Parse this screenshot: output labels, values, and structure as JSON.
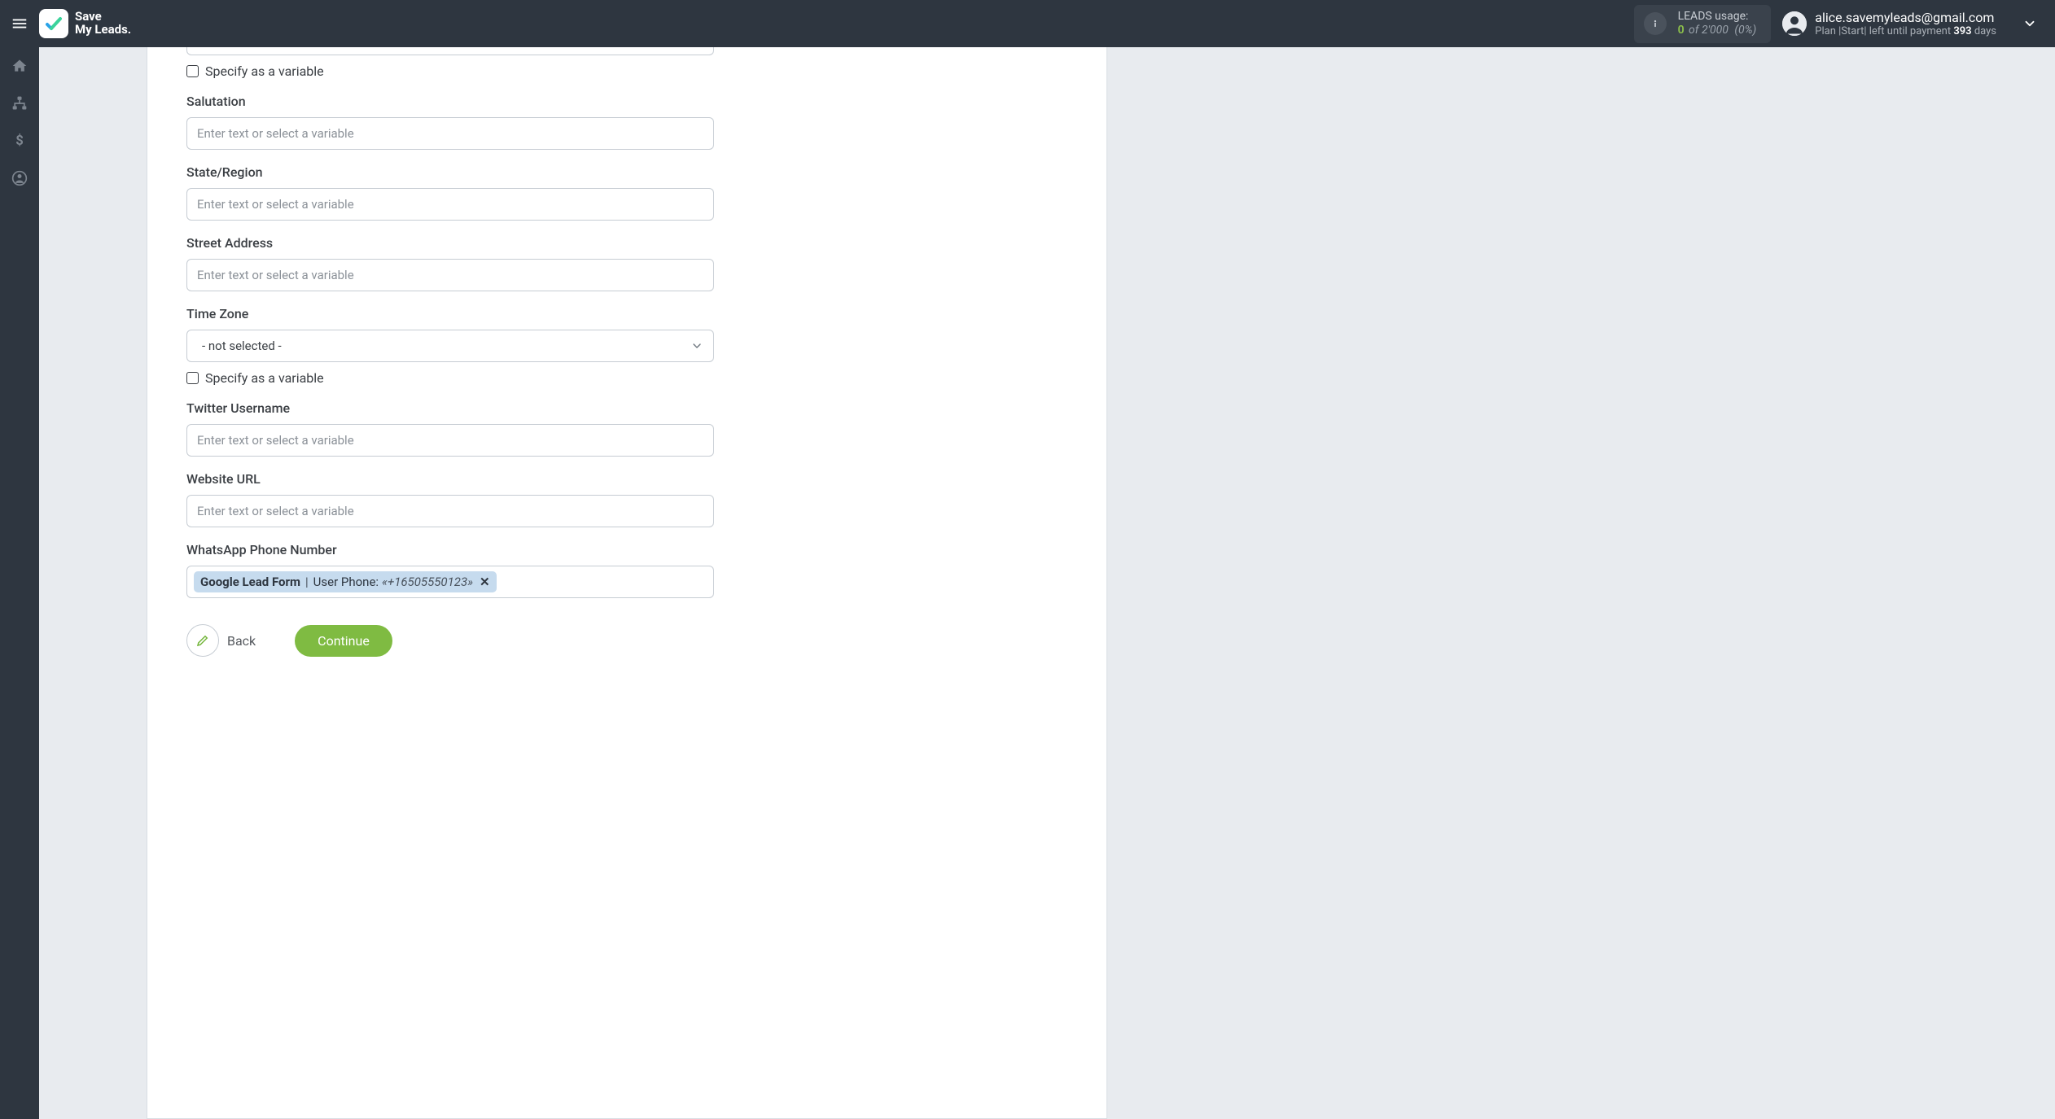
{
  "header": {
    "brand_line1": "Save",
    "brand_line2": "My Leads.",
    "usage_label": "LEADS usage:",
    "usage_zero": "0",
    "usage_of": "of 2'000",
    "usage_pct": "(0%)",
    "user_email": "alice.savemyleads@gmail.com",
    "plan_prefix": "Plan |Start| left until payment ",
    "plan_days_number": "393",
    "plan_days_suffix": " days"
  },
  "form": {
    "specify_as_variable": "Specify as a variable",
    "placeholder": "Enter text or select a variable",
    "not_selected": "- not selected -",
    "labels": {
      "salutation": "Salutation",
      "state_region": "State/Region",
      "street_address": "Street Address",
      "time_zone": "Time Zone",
      "twitter_username": "Twitter Username",
      "website_url": "Website URL",
      "whatsapp_phone": "WhatsApp Phone Number"
    },
    "whatsapp_tag": {
      "source": "Google Lead Form",
      "field": "User Phone:",
      "value": "«+16505550123»",
      "remove_glyph": "✕"
    }
  },
  "buttons": {
    "back": "Back",
    "continue": "Continue"
  }
}
